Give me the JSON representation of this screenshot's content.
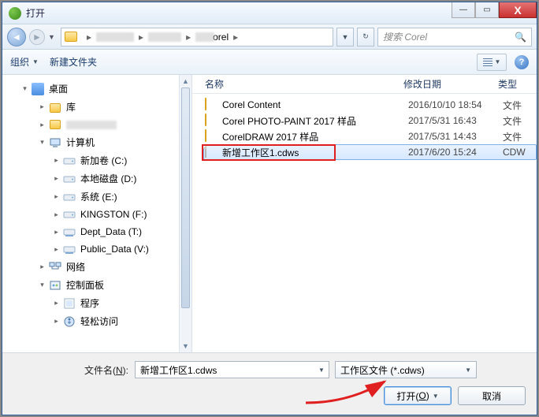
{
  "title": "打开",
  "address": {
    "crumb_last": "orel",
    "refresh": "↻"
  },
  "search": {
    "placeholder": "搜索 Corel"
  },
  "toolbar": {
    "organize": "组织",
    "newfolder": "新建文件夹",
    "help": "?"
  },
  "tree": {
    "desktop": "桌面",
    "library": "库",
    "computer": "计算机",
    "drives": {
      "c": "新加卷 (C:)",
      "d": "本地磁盘 (D:)",
      "e": "系统 (E:)",
      "f": "KINGSTON (F:)",
      "t": "Dept_Data (T:)",
      "v": "Public_Data (V:)"
    },
    "network": "网络",
    "cpanel": "控制面板",
    "programs": "程序",
    "ease": "轻松访问"
  },
  "list": {
    "headers": {
      "name": "名称",
      "date": "修改日期",
      "type": "类型"
    },
    "rows": [
      {
        "name": "Corel Content",
        "date": "2016/10/10 18:54",
        "type": "文件",
        "kind": "folder"
      },
      {
        "name": "Corel PHOTO-PAINT 2017 样品",
        "date": "2017/5/31 16:43",
        "type": "文件",
        "kind": "folder"
      },
      {
        "name": "CorelDRAW 2017 样品",
        "date": "2017/5/31 14:43",
        "type": "文件",
        "kind": "folder"
      },
      {
        "name": "新增工作区1.cdws",
        "date": "2017/6/20 15:24",
        "type": "CDW",
        "kind": "file",
        "selected": true
      }
    ]
  },
  "bottom": {
    "filename_label_pre": "文件名(",
    "filename_label_key": "N",
    "filename_label_post": "):",
    "filename_value": "新增工作区1.cdws",
    "filter": "工作区文件 (*.cdws)",
    "open_pre": "打开(",
    "open_key": "O",
    "open_post": ")",
    "cancel": "取消"
  },
  "winbtn": {
    "close": "X"
  }
}
